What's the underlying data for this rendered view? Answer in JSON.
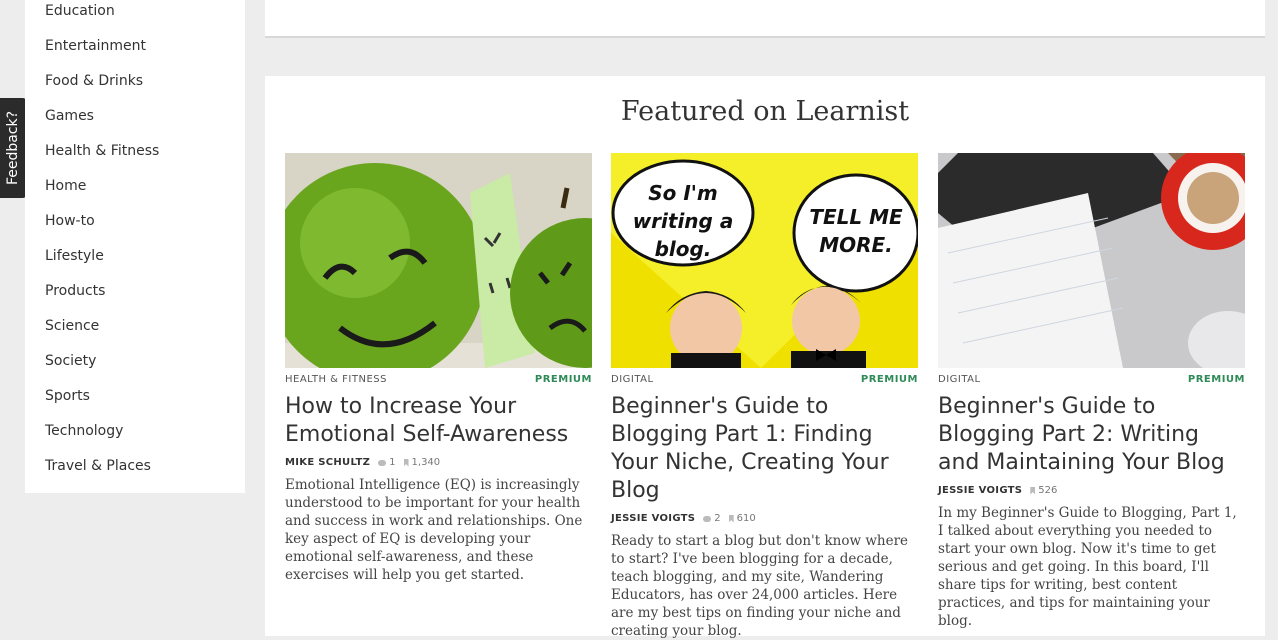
{
  "sidebar": {
    "items": [
      {
        "label": "Education"
      },
      {
        "label": "Entertainment"
      },
      {
        "label": "Food & Drinks"
      },
      {
        "label": "Games"
      },
      {
        "label": "Health & Fitness"
      },
      {
        "label": "Home"
      },
      {
        "label": "How-to"
      },
      {
        "label": "Lifestyle"
      },
      {
        "label": "Products"
      },
      {
        "label": "Science"
      },
      {
        "label": "Society"
      },
      {
        "label": "Sports"
      },
      {
        "label": "Technology"
      },
      {
        "label": "Travel & Places"
      }
    ]
  },
  "feedback": {
    "label": "Feedback?"
  },
  "featured": {
    "heading": "Featured on Learnist",
    "cards": [
      {
        "category": "HEALTH & FITNESS",
        "badge": "PREMIUM",
        "title": "How to Increase Your Emotional Self-Awareness",
        "author": "MIKE SCHULTZ",
        "comments": "1",
        "saves": "1,340",
        "description": "Emotional Intelligence (EQ) is increasingly understood to be important for your health and success in work and relationships. One key aspect of EQ is developing your emotional self-awareness, and these exercises will help you get started."
      },
      {
        "category": "DIGITAL",
        "badge": "PREMIUM",
        "title": "Beginner's Guide to Blogging Part 1: Finding Your Niche, Creating Your Blog",
        "author": "JESSIE VOIGTS",
        "comments": "2",
        "saves": "610",
        "description": "Ready to start a blog but don't know where to start? I've been blogging for a decade, teach blogging, and my site, Wandering Educators, has over 24,000 articles. Here are my best tips on finding your niche and creating your blog.",
        "image_text_left": "So I'm writing a blog.",
        "image_text_right": "TELL ME MORE."
      },
      {
        "category": "DIGITAL",
        "badge": "PREMIUM",
        "title": "Beginner's Guide to Blogging Part 2: Writing and Maintaining Your Blog",
        "author": "JESSIE VOIGTS",
        "saves": "526",
        "description": "In my Beginner's Guide to Blogging, Part 1, I talked about everything you needed to start your own blog. Now it's time to get serious and get going. In this board, I'll share tips for writing, best content practices, and tips for maintaining your blog."
      }
    ]
  },
  "colors": {
    "premium": "#2e8b57",
    "background": "#ededed",
    "panel": "#ffffff"
  }
}
